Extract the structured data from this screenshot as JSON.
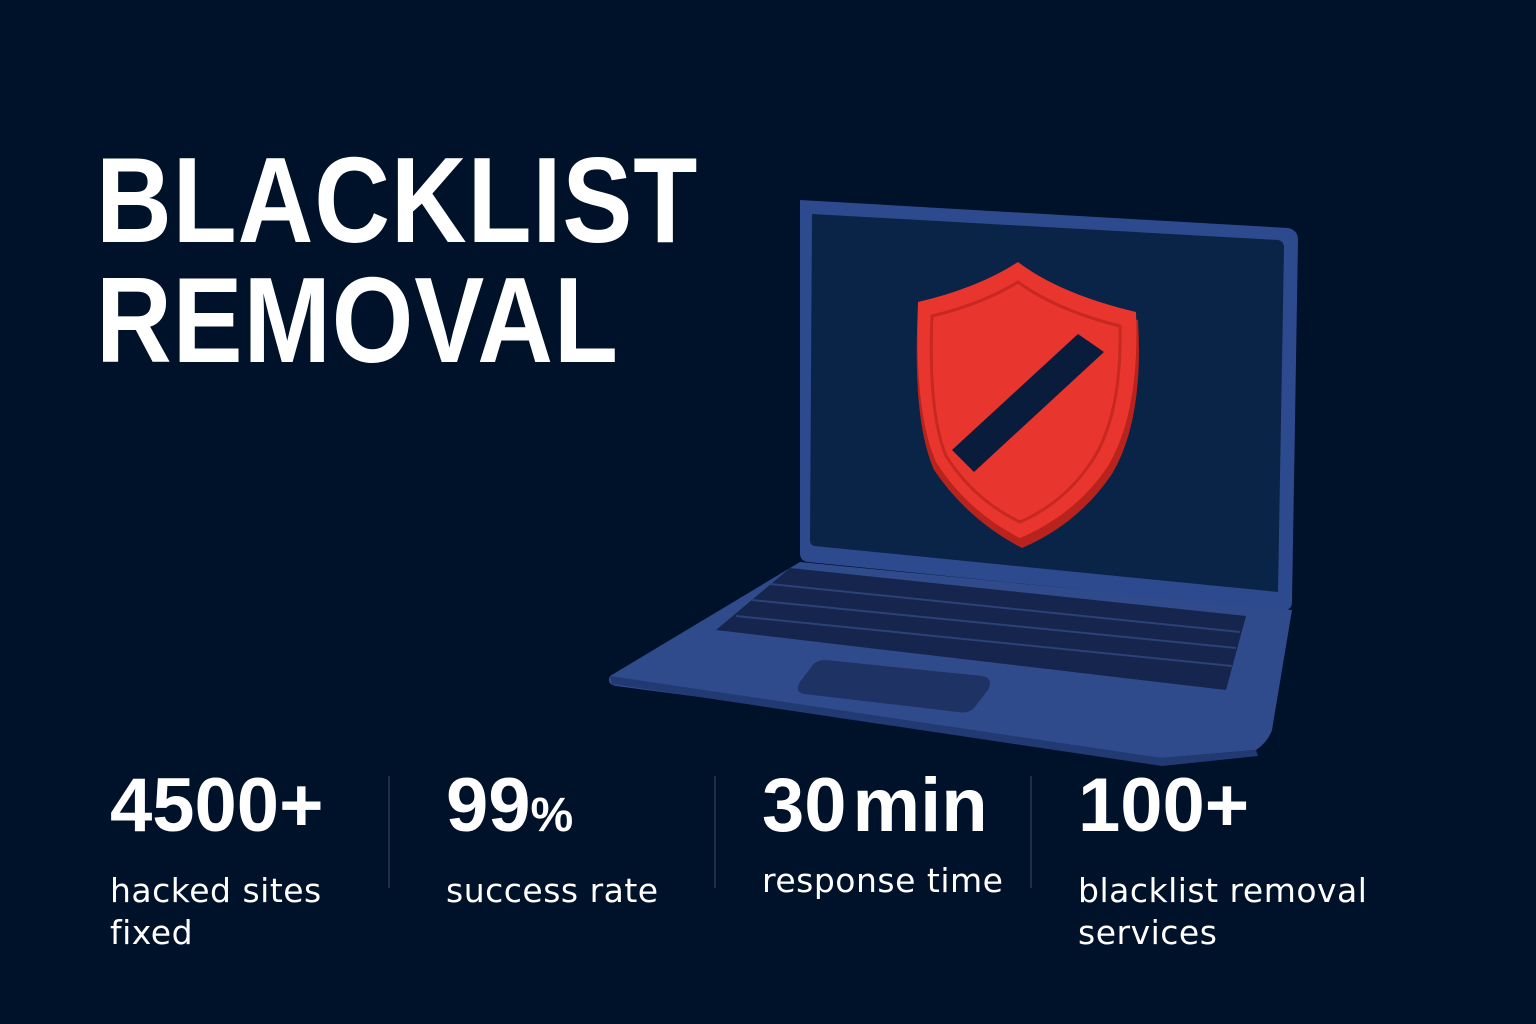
{
  "colors": {
    "background": "#00112a",
    "text": "#ffffff",
    "laptop_body": "#2e4a8e",
    "laptop_screen": "#0a2447",
    "shield": "#e8352d",
    "divider": "#1f2c4a"
  },
  "headline": {
    "line1": "BLACKLIST",
    "line2": "REMOVAL"
  },
  "illustration": {
    "icon": "laptop-icon",
    "screen_icon": "shield-blocked-icon"
  },
  "stats": [
    {
      "value": "4500+",
      "unit": "",
      "label_line1": "hacked sites",
      "label_line2": "fixed"
    },
    {
      "value": "99",
      "unit": "%",
      "label_line1": "success rate",
      "label_line2": ""
    },
    {
      "value": "30",
      "unit": "min",
      "label_line1": "response time",
      "label_line2": ""
    },
    {
      "value": "100+",
      "unit": "",
      "label_line1": "blacklist removal",
      "label_line2": "services"
    }
  ]
}
